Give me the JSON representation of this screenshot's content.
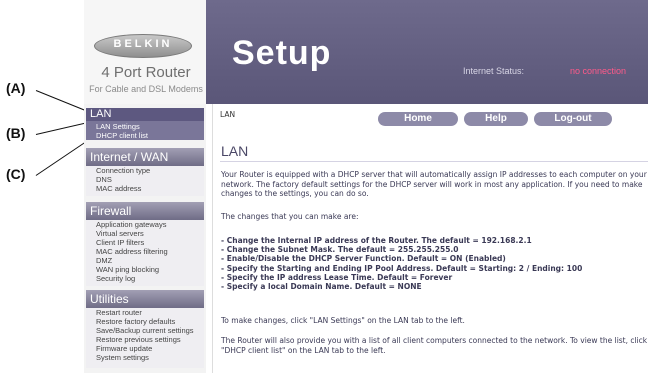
{
  "annotations": [
    {
      "label": "(A)"
    },
    {
      "label": "(B)"
    },
    {
      "label": "(C)"
    }
  ],
  "brand": {
    "logo_text": "BELKIN",
    "product_name": "4 Port Router",
    "product_sub": "For Cable and DSL Modems"
  },
  "header": {
    "title": "Setup",
    "status_label": "Internet Status:",
    "status_value": "no connection"
  },
  "nav": {
    "lan": {
      "label": "LAN",
      "items": [
        "LAN Settings",
        "DHCP client list"
      ]
    },
    "internet_wan": {
      "label": "Internet / WAN",
      "items": [
        "Connection type",
        "DNS",
        "MAC address"
      ]
    },
    "firewall": {
      "label": "Firewall",
      "items": [
        "Application gateways",
        "Virtual servers",
        "Client IP filters",
        "MAC address filtering",
        "DMZ",
        "WAN ping blocking",
        "Security log"
      ]
    },
    "utilities": {
      "label": "Utilities",
      "items": [
        "Restart router",
        "Restore factory defaults",
        "Save/Backup current settings",
        "Restore previous settings",
        "Firmware update",
        "System settings"
      ]
    }
  },
  "breadcrumb": "LAN",
  "buttons": {
    "home": "Home",
    "help": "Help",
    "logout": "Log-out"
  },
  "content": {
    "title": "LAN",
    "intro": "Your Router is equipped with a DHCP server that will automatically assign IP addresses to each computer on your network. The factory default settings for the DHCP server will work in most any application. If you need to make changes to the settings, you can do so.",
    "changes_intro": "The changes that you can make are:",
    "bullets": [
      "- Change the Internal IP address of the Router. The default = 192.168.2.1",
      "- Change the Subnet Mask. The default = 255.255.255.0",
      "- Enable/Disable the DHCP Server Function. Default = ON (Enabled)",
      "- Specify the Starting and Ending IP Pool Address. Default = Starting: 2 / Ending: 100",
      "- Specify the IP address Lease Time. Default = Forever",
      "- Specify a local Domain Name. Default = NONE"
    ],
    "make_changes": "To make changes, click \"LAN Settings\" on the LAN tab to the left.",
    "client_list": "The Router will also provide you with a list of all client computers connected to the network. To view the list, click \"DHCP client list\" on the LAN tab to the left."
  }
}
